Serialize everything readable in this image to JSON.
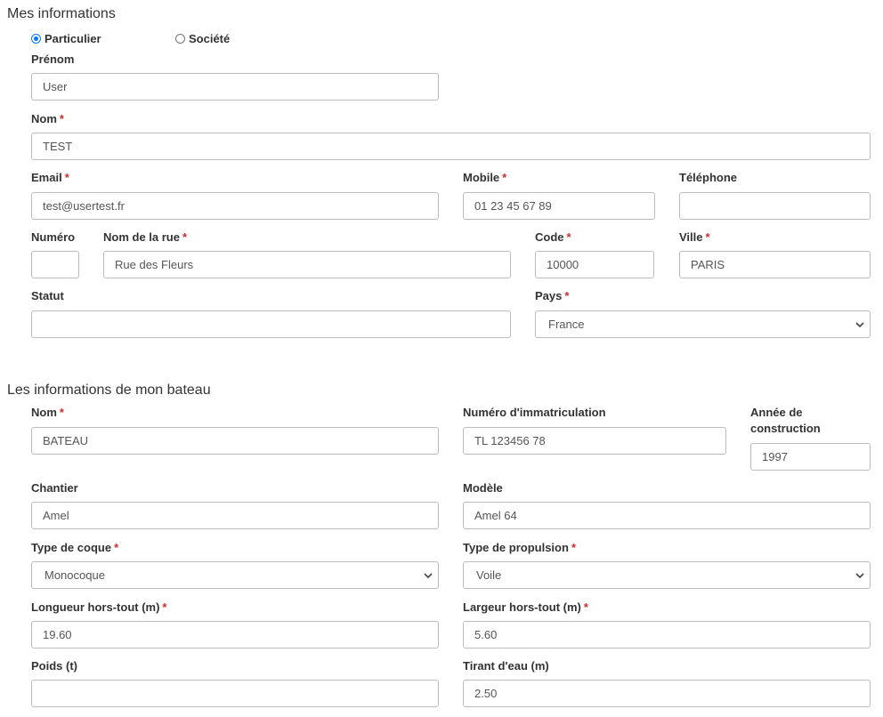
{
  "personal": {
    "title": "Mes informations",
    "type_options": [
      "Particulier",
      "Société"
    ],
    "selected_type": "Particulier",
    "prenom": {
      "label": "Prénom",
      "value": "User"
    },
    "nom": {
      "label": "Nom",
      "required": "*",
      "value": "TEST"
    },
    "email": {
      "label": "Email",
      "required": "*",
      "value": "test@usertest.fr"
    },
    "mobile": {
      "label": "Mobile",
      "required": "*",
      "value": "01 23 45 67 89"
    },
    "telephone": {
      "label": "Téléphone",
      "value": ""
    },
    "numero": {
      "label": "Numéro",
      "value": ""
    },
    "rue": {
      "label": "Nom de la rue",
      "required": "*",
      "value": "Rue des Fleurs"
    },
    "code": {
      "label": "Code",
      "required": "*",
      "value": "10000"
    },
    "ville": {
      "label": "Ville",
      "required": "*",
      "value": "PARIS"
    },
    "statut": {
      "label": "Statut",
      "value": ""
    },
    "pays": {
      "label": "Pays",
      "required": "*",
      "value": "France"
    }
  },
  "boat": {
    "title": "Les informations de mon bateau",
    "nom": {
      "label": "Nom",
      "required": "*",
      "value": "BATEAU"
    },
    "immatriculation": {
      "label": "Numéro d'immatriculation",
      "value": "TL 123456 78"
    },
    "annee": {
      "label_line1": "Année de",
      "label_line2": "construction",
      "value": "1997"
    },
    "chantier": {
      "label": "Chantier",
      "value": "Amel"
    },
    "modele": {
      "label": "Modèle",
      "value": "Amel 64"
    },
    "coque": {
      "label": "Type de coque",
      "required": "*",
      "value": "Monocoque"
    },
    "propulsion": {
      "label": "Type de propulsion",
      "required": "*",
      "value": "Voile"
    },
    "longueur": {
      "label": "Longueur hors-tout (m)",
      "required": "*",
      "value": "19.60"
    },
    "largeur": {
      "label": "Largeur hors-tout (m)",
      "required": "*",
      "value": "5.60"
    },
    "poids": {
      "label": "Poids (t)",
      "value": ""
    },
    "tirant": {
      "label": "Tirant d'eau (m)",
      "value": "2.50"
    }
  },
  "icons": {
    "select_arrow": "chevron-down-icon",
    "radio": "radio-icon"
  },
  "colors": {
    "required_star": "#c9302c",
    "radio_checked": "#0075ff",
    "input_border": "#bdbdbd"
  }
}
